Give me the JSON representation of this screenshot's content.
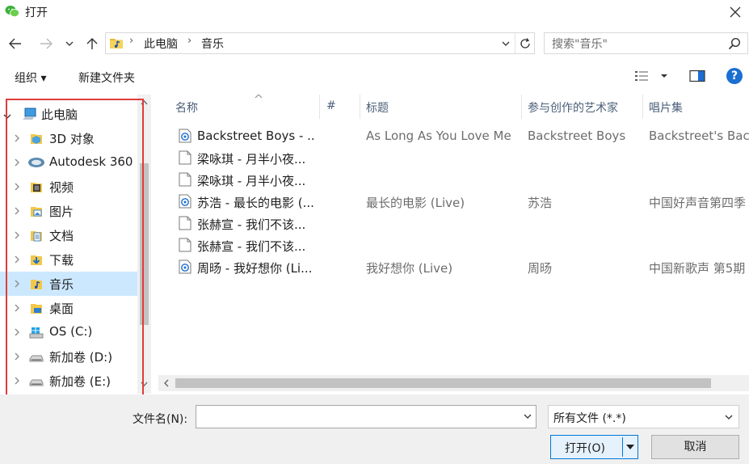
{
  "window": {
    "title": "打开",
    "close_glyph": "✕"
  },
  "nav": {
    "back_icon": "arrow-left-icon",
    "forward_icon": "arrow-right-icon",
    "recent_icon": "chevron-down-icon",
    "up_icon": "arrow-up-icon"
  },
  "address": {
    "segments": [
      "此电脑",
      "音乐"
    ]
  },
  "search": {
    "placeholder": "搜索\"音乐\""
  },
  "toolbar": {
    "organize": "组织 ▾",
    "new_folder": "新建文件夹",
    "help": "?"
  },
  "sidebar": {
    "items": [
      {
        "label": "此电脑",
        "icon": "computer-icon",
        "expanded": true
      },
      {
        "label": "3D 对象",
        "icon": "3d-objects-icon"
      },
      {
        "label": "Autodesk 360",
        "icon": "autodesk-360-icon"
      },
      {
        "label": "视频",
        "icon": "videos-icon"
      },
      {
        "label": "图片",
        "icon": "pictures-icon"
      },
      {
        "label": "文档",
        "icon": "documents-icon"
      },
      {
        "label": "下载",
        "icon": "downloads-icon"
      },
      {
        "label": "音乐",
        "icon": "music-folder-icon",
        "selected": true
      },
      {
        "label": "桌面",
        "icon": "desktop-icon"
      },
      {
        "label": "OS (C:)",
        "icon": "windows-drive-icon"
      },
      {
        "label": "新加卷 (D:)",
        "icon": "drive-icon"
      },
      {
        "label": "新加卷 (E:)",
        "icon": "drive-icon"
      }
    ]
  },
  "columns": {
    "name": "名称",
    "number": "#",
    "title": "标题",
    "artist": "参与创作的艺术家",
    "album": "唱片集"
  },
  "files": [
    {
      "name": "Backstreet Boys - ...",
      "title": "As Long As You Love Me",
      "artist": "Backstreet Boys",
      "album": "Backstreet's Back",
      "type": "audio"
    },
    {
      "name": "梁咏琪 - 月半小夜...",
      "title": "",
      "artist": "",
      "album": "",
      "type": "file"
    },
    {
      "name": "梁咏琪 - 月半小夜...",
      "title": "",
      "artist": "",
      "album": "",
      "type": "file"
    },
    {
      "name": "苏浩 - 最长的电影 (...",
      "title": "最长的电影 (Live)",
      "artist": "苏浩",
      "album": "中国好声音第四季",
      "type": "audio"
    },
    {
      "name": "张赫宣 - 我们不该...",
      "title": "",
      "artist": "",
      "album": "",
      "type": "file"
    },
    {
      "name": "张赫宣 - 我们不该...",
      "title": "",
      "artist": "",
      "album": "",
      "type": "file"
    },
    {
      "name": "周旸 - 我好想你 (Li...",
      "title": "我好想你 (Live)",
      "artist": "周旸",
      "album": "中国新歌声 第5期",
      "type": "audio"
    }
  ],
  "bottom": {
    "filename_label": "文件名(N):",
    "filename_value": "",
    "filetype": "所有文件 (*.*)",
    "open": "打开(O)",
    "cancel": "取消"
  },
  "colors": {
    "selected": "#cce8ff",
    "accent": "#0078d7",
    "highlight_border": "#e03c3c"
  }
}
